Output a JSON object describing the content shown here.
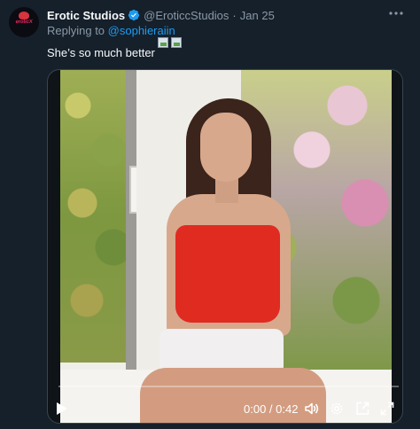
{
  "tweet": {
    "display_name": "Erotic Studios",
    "handle": "@EroticcStudios",
    "separator": "·",
    "date": "Jan 25",
    "reply_prefix": "Replying to",
    "reply_mention": "@sophieraiin",
    "text": "She’s so much better",
    "avatar_logo_text": "eroticX"
  },
  "video": {
    "time_display": "0:00 / 0:42",
    "progress": 0
  },
  "colors": {
    "background": "#15202b",
    "accent": "#1d9bf0",
    "secondary_text": "#8b98a5",
    "primary_text": "#f7f9f9"
  },
  "icons": {
    "verified": "verified-badge-icon",
    "more": "more-horizontal-icon",
    "play": "play-icon",
    "volume": "volume-icon",
    "settings": "settings-gear-icon",
    "dock": "picture-in-picture-icon",
    "fullscreen": "fullscreen-expand-icon"
  }
}
